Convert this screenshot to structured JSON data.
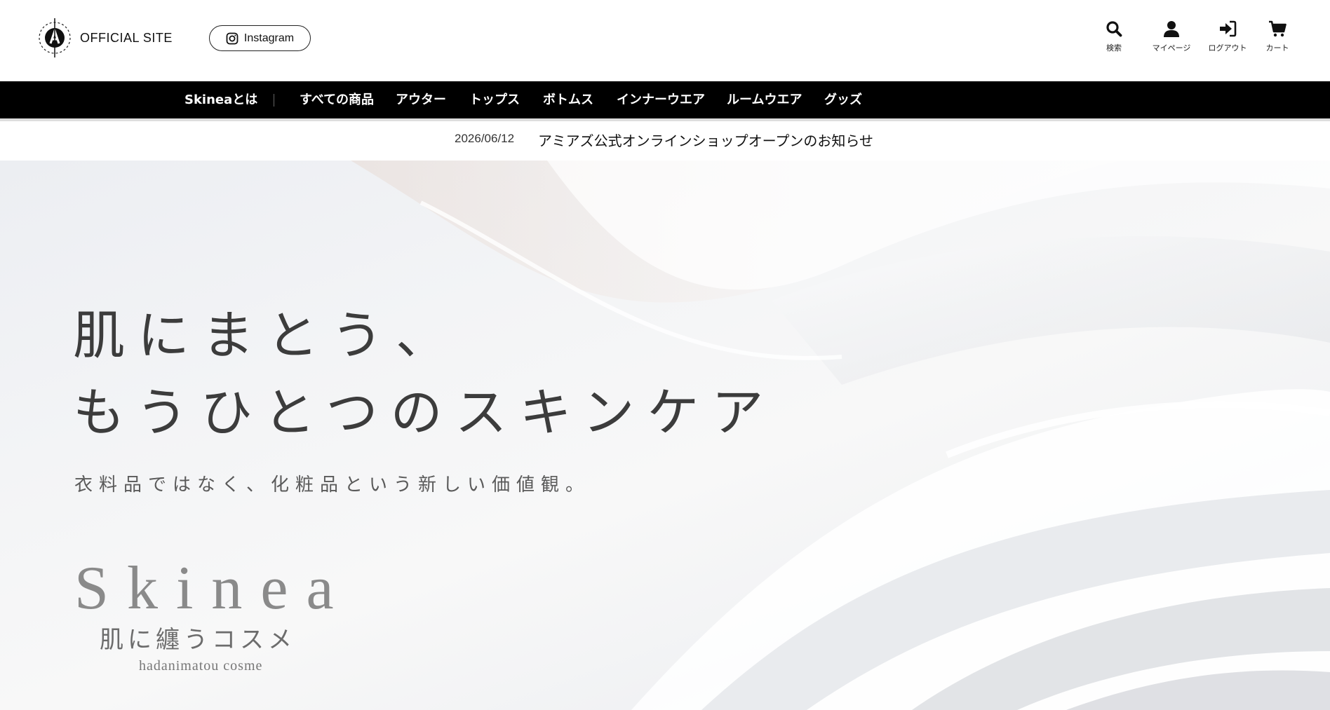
{
  "header": {
    "logo_text": "OFFICIAL SITE",
    "instagram_label": "Instagram",
    "utility": {
      "search": "検索",
      "mypage": "マイページ",
      "logout": "ログアウト",
      "cart": "カート"
    }
  },
  "nav": {
    "items": [
      "Skineaとは",
      "すべての商品",
      "アウター",
      "トップス",
      "ボトムス",
      "インナーウエア",
      "ルームウエア",
      "グッズ"
    ]
  },
  "news": {
    "date": "2026/06/12",
    "title": "アミアズ公式オンラインショップオープンのお知らせ"
  },
  "hero": {
    "headline_line1": "肌にまとう、",
    "headline_line2": "もうひとつのスキンケア",
    "subheadline": "衣料品ではなく、化粧品という新しい価値観。",
    "brand_name": "Skinea",
    "brand_jp": "肌に纏うコスメ",
    "brand_en": "hadanimatou cosme"
  },
  "icons": [
    "logo-mark",
    "instagram-icon",
    "search-icon",
    "user-icon",
    "logout-icon",
    "cart-icon"
  ],
  "colors": {
    "nav_bg": "#000000",
    "nav_text": "#ffffff",
    "hero_text": "#3c3c3c"
  }
}
